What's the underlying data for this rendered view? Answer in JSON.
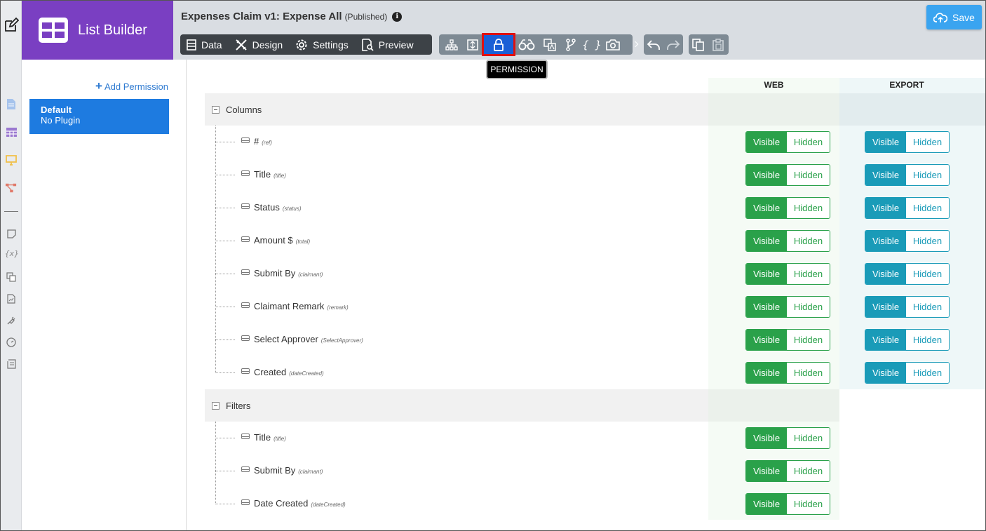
{
  "brand": {
    "title": "List Builder"
  },
  "header": {
    "title": "Expenses Claim v1: Expense All",
    "status": "(Published)",
    "info_glyph": "i"
  },
  "toolbar": {
    "data_label": "Data",
    "design_label": "Design",
    "settings_label": "Settings",
    "preview_label": "Preview",
    "icon_buttons": [
      "sitemap-icon",
      "split-icon",
      "lock-icon",
      "binoculars-icon",
      "translate-icon",
      "branch-icon",
      "braces-icon",
      "camera-icon"
    ],
    "braces_glyph": "{ }",
    "tooltip": "PERMISSION",
    "save_label": "Save"
  },
  "rail": {
    "variable_glyph": "{x}"
  },
  "permissions": {
    "add_label": "Add Permission",
    "add_glyph": "+",
    "items": [
      {
        "name": "Default",
        "plugin": "No Plugin"
      }
    ]
  },
  "columns_head": {
    "web": "WEB",
    "export": "EXPORT"
  },
  "toggle": {
    "visible": "Visible",
    "hidden": "Hidden"
  },
  "sections": [
    {
      "label": "Columns",
      "rows": [
        {
          "label": "#",
          "key": "(ref)"
        },
        {
          "label": "Title",
          "key": "(title)"
        },
        {
          "label": "Status",
          "key": "(status)"
        },
        {
          "label": "Amount $",
          "key": "(total)"
        },
        {
          "label": "Submit By",
          "key": "(claimant)"
        },
        {
          "label": "Claimant Remark",
          "key": "(remark)"
        },
        {
          "label": "Select Approver",
          "key": "(SelectApprover)"
        },
        {
          "label": "Created",
          "key": "(dateCreated)"
        }
      ]
    },
    {
      "label": "Filters",
      "rows": [
        {
          "label": "Title",
          "key": "(title)"
        },
        {
          "label": "Submit By",
          "key": "(claimant)"
        },
        {
          "label": "Date Created",
          "key": "(dateCreated)"
        }
      ]
    }
  ],
  "colors": {
    "brand": "#7a3fc2",
    "active": "#1a5fd6",
    "web": "#2aa14a",
    "export": "#1a9bb8",
    "save": "#3aa4f0"
  }
}
